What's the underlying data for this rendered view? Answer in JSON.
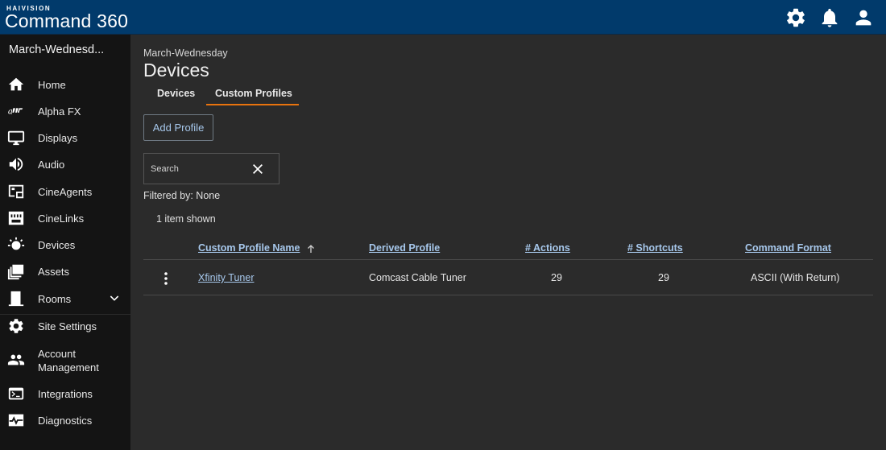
{
  "header": {
    "brand_small": "HAIVISION",
    "brand_name": "Command 360",
    "icons": [
      "settings-gear-icon",
      "bell-icon",
      "user-icon"
    ]
  },
  "sidebar": {
    "site_name": "March-Wednesd...",
    "items": [
      {
        "label": "Home",
        "icon": "home-icon"
      },
      {
        "label": "Alpha FX",
        "icon": "alpha-fx-icon"
      },
      {
        "label": "Displays",
        "icon": "monitor-icon"
      },
      {
        "label": "Audio",
        "icon": "speaker-icon"
      },
      {
        "label": "CineAgents",
        "icon": "cineagents-icon"
      },
      {
        "label": "CineLinks",
        "icon": "cinelinks-icon"
      },
      {
        "label": "Devices",
        "icon": "devices-icon"
      },
      {
        "label": "Assets",
        "icon": "assets-icon"
      },
      {
        "label": "Rooms",
        "icon": "door-icon"
      },
      {
        "label": "Site Settings",
        "icon": "gear-icon"
      },
      {
        "label": "Account Management",
        "icon": "users-icon"
      },
      {
        "label": "Integrations",
        "icon": "terminal-icon"
      },
      {
        "label": "Diagnostics",
        "icon": "pulse-icon"
      }
    ]
  },
  "main": {
    "breadcrumb": "March-Wednesday",
    "title": "Devices",
    "tabs": [
      {
        "label": "Devices",
        "active": false
      },
      {
        "label": "Custom Profiles",
        "active": true
      }
    ],
    "add_button": "Add Profile",
    "search": {
      "placeholder": "Search",
      "value": ""
    },
    "filtered_by": "Filtered by: None",
    "count": "1 item shown",
    "table": {
      "columns": [
        "Custom Profile Name",
        "Derived Profile",
        "# Actions",
        "# Shortcuts",
        "Command Format"
      ],
      "rows": [
        {
          "name": "Xfinity Tuner",
          "derived": "Comcast Cable Tuner",
          "actions": "29",
          "shortcuts": "29",
          "format": "ASCII (With Return)"
        }
      ]
    }
  },
  "colors": {
    "topbar": "#013a6b",
    "sidebar": "#141414",
    "main_bg": "#2b2b2b",
    "link": "#a7c8ec",
    "tab_accent": "#e8730e"
  }
}
